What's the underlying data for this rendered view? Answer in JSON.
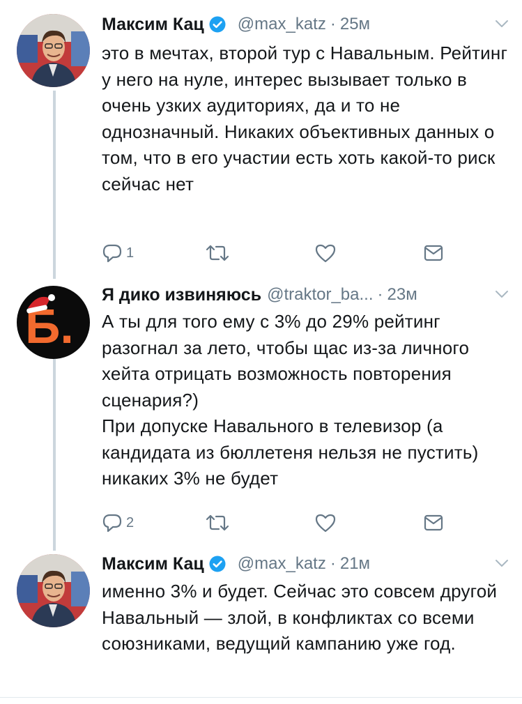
{
  "colors": {
    "text": "#14171a",
    "secondary": "#657786",
    "verified": "#1da1f2",
    "thread_line": "#ccd6dd",
    "icon": "#657786"
  },
  "tweets": [
    {
      "name": "Максим Кац",
      "verified": true,
      "handle": "@max_katz",
      "time": "25м",
      "text": "это в мечтах, второй тур с Навальным. Рейтинг у него на нуле, интерес вызывает только в очень узких аудиториях, да и то не однозначный. Никаких объективных данных о том, что в его участии есть хоть какой-то риск сейчас нет",
      "reply_count": "1"
    },
    {
      "name": "Я дико извиняюсь",
      "verified": false,
      "handle": "@traktor_ba...",
      "time": "23м",
      "text": "А ты для того ему с 3% до 29% рейтинг разогнал за лето, чтобы щас из-за личного хейта отрицать возможность повторения сценария?)\nПри допуске Навального в телевизор (а кандидата из бюллетеня нельзя не пустить) никаких 3% не будет",
      "reply_count": "2",
      "avatar_letter": "Б."
    },
    {
      "name": "Максим Кац",
      "verified": true,
      "handle": "@max_katz",
      "time": "21м",
      "text": "именно 3% и будет. Сейчас это совсем другой Навальный — злой, в конфликтах со всеми союзниками, ведущий кампанию уже год."
    }
  ],
  "separator": "·",
  "icons": {
    "reply": "reply-icon",
    "retweet": "retweet-icon",
    "like": "heart-icon",
    "dm": "envelope-icon",
    "caret": "chevron-down-icon",
    "verified": "verified-badge-icon"
  }
}
